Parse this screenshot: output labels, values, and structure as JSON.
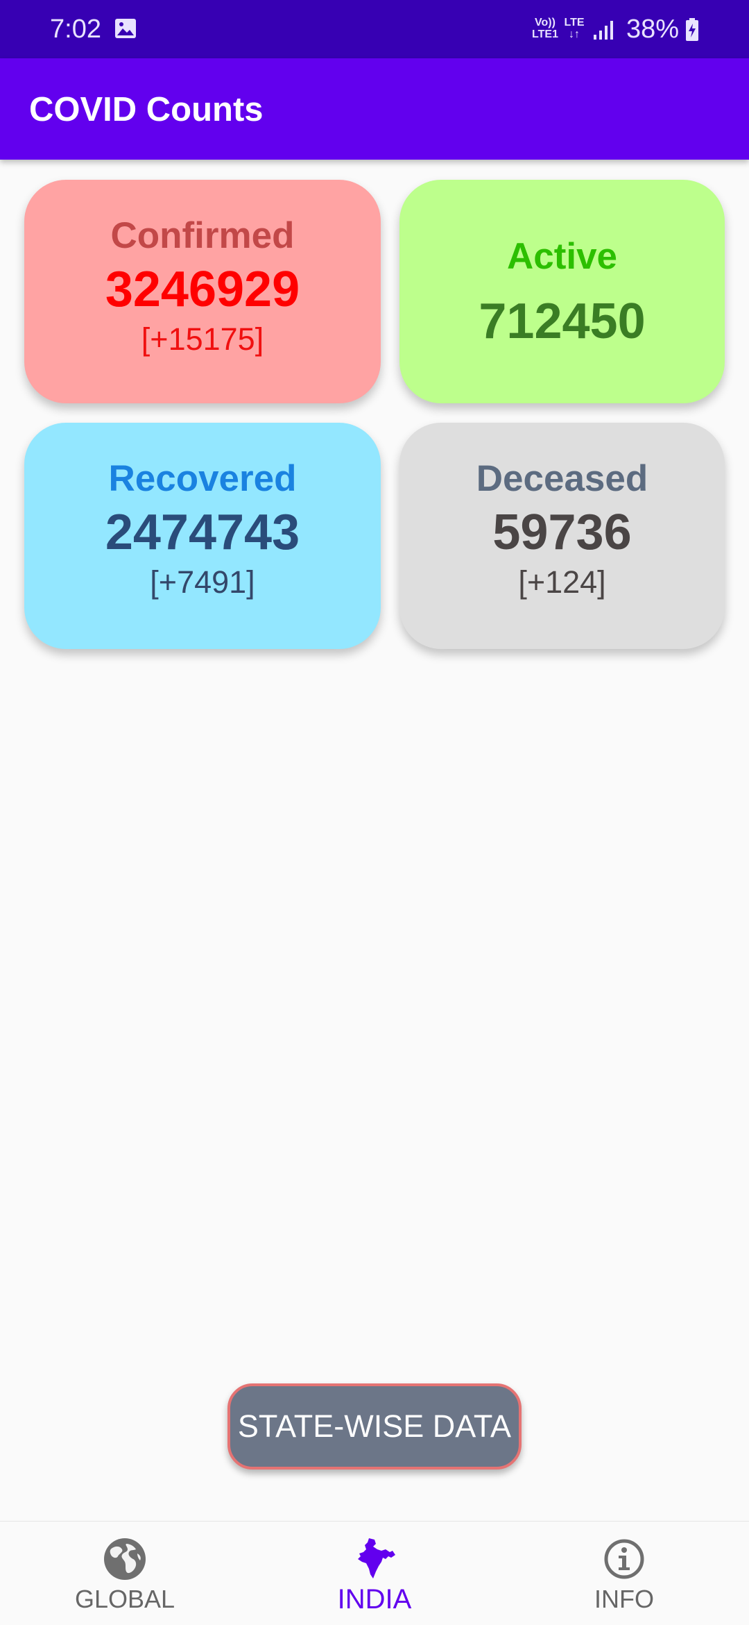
{
  "status_bar": {
    "time": "7:02",
    "volte_line1": "Vo))",
    "volte_line2": "LTE1",
    "lte": "LTE",
    "battery": "38%",
    "icons": [
      "gallery-icon",
      "signal-icon",
      "battery-charging-icon"
    ]
  },
  "app_bar": {
    "title": "COVID Counts"
  },
  "cards": {
    "confirmed": {
      "label": "Confirmed",
      "count": "3246929",
      "delta": "[+15175]"
    },
    "active": {
      "label": "Active",
      "count": "712450"
    },
    "recovered": {
      "label": "Recovered",
      "count": "2474743",
      "delta": "[+7491]"
    },
    "deceased": {
      "label": "Deceased",
      "count": "59736",
      "delta": "[+124]"
    }
  },
  "colors": {
    "app_bar": "#6200ee",
    "status_bar": "#3700b3",
    "confirmed_bg": "#ffa3a3",
    "active_bg": "#bdff8c",
    "recovered_bg": "#93e7ff",
    "deceased_bg": "#dedede",
    "nav_active": "#6200ee"
  },
  "state_button": {
    "label": "STATE-WISE DATA"
  },
  "bottom_nav": {
    "items": [
      {
        "label": "GLOBAL",
        "icon": "globe-icon",
        "active": false
      },
      {
        "label": "INDIA",
        "icon": "india-map-icon",
        "active": true
      },
      {
        "label": "INFO",
        "icon": "info-icon",
        "active": false
      }
    ]
  }
}
